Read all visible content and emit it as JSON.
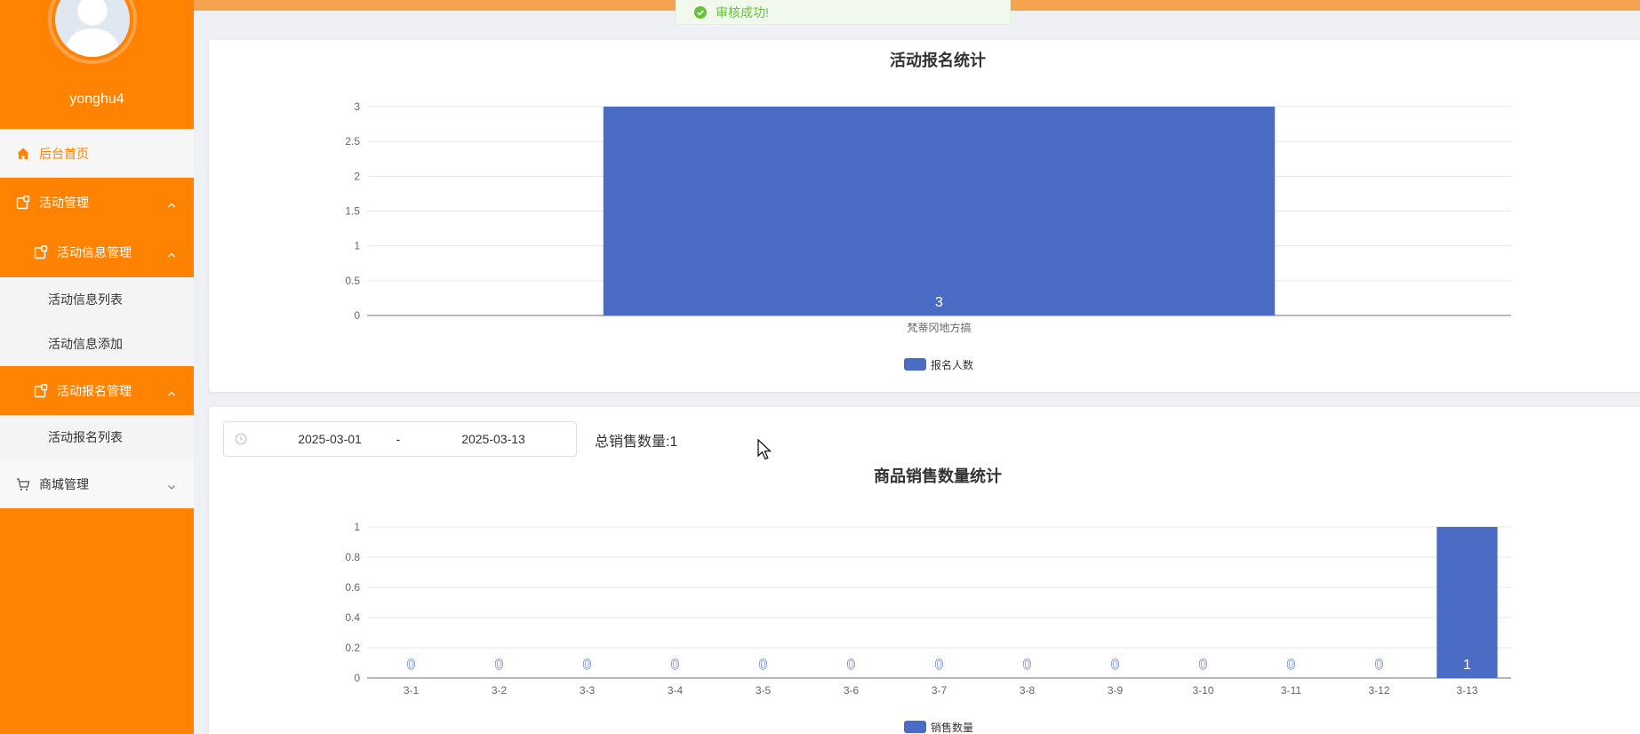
{
  "user": {
    "username": "yonghu4"
  },
  "toast": {
    "text": "审核成功!"
  },
  "sidebar": {
    "home": "后台首页",
    "activity_mgmt": "活动管理",
    "activity_info_mgmt": "活动信息管理",
    "activity_info_list": "活动信息列表",
    "activity_info_add": "活动信息添加",
    "signup_mgmt": "活动报名管理",
    "signup_list": "活动报名列表",
    "mall_mgmt": "商城管理"
  },
  "filters": {
    "start_date": "2025-03-01",
    "separator": "-",
    "end_date": "2025-03-13",
    "total_label": "总销售数量:",
    "total_value": "1"
  },
  "colors": {
    "accent": "#ff8200",
    "bar": "#4a6cc5",
    "success": "#67c23a"
  },
  "chart_data": [
    {
      "type": "bar",
      "title": "活动报名统计",
      "categories": [
        "梵蒂冈地方搞"
      ],
      "series": [
        {
          "name": "报名人数",
          "values": [
            3
          ]
        }
      ],
      "ylim": [
        0,
        3
      ],
      "yticks": [
        "0",
        "0.5",
        "1",
        "1.5",
        "2",
        "2.5",
        "3"
      ],
      "grid": true,
      "legend": "bottom-center",
      "data_labels": [
        "3"
      ]
    },
    {
      "type": "bar",
      "title": "商品销售数量统计",
      "categories": [
        "3-1",
        "3-2",
        "3-3",
        "3-4",
        "3-5",
        "3-6",
        "3-7",
        "3-8",
        "3-9",
        "3-10",
        "3-11",
        "3-12",
        "3-13"
      ],
      "series": [
        {
          "name": "销售数量",
          "values": [
            0,
            0,
            0,
            0,
            0,
            0,
            0,
            0,
            0,
            0,
            0,
            0,
            1
          ]
        }
      ],
      "ylim": [
        0,
        1
      ],
      "yticks": [
        "0",
        "0.2",
        "0.4",
        "0.6",
        "0.8",
        "1"
      ],
      "grid": true,
      "legend": "bottom-center",
      "data_labels": [
        "0",
        "0",
        "0",
        "0",
        "0",
        "0",
        "0",
        "0",
        "0",
        "0",
        "0",
        "0",
        "1"
      ]
    }
  ]
}
